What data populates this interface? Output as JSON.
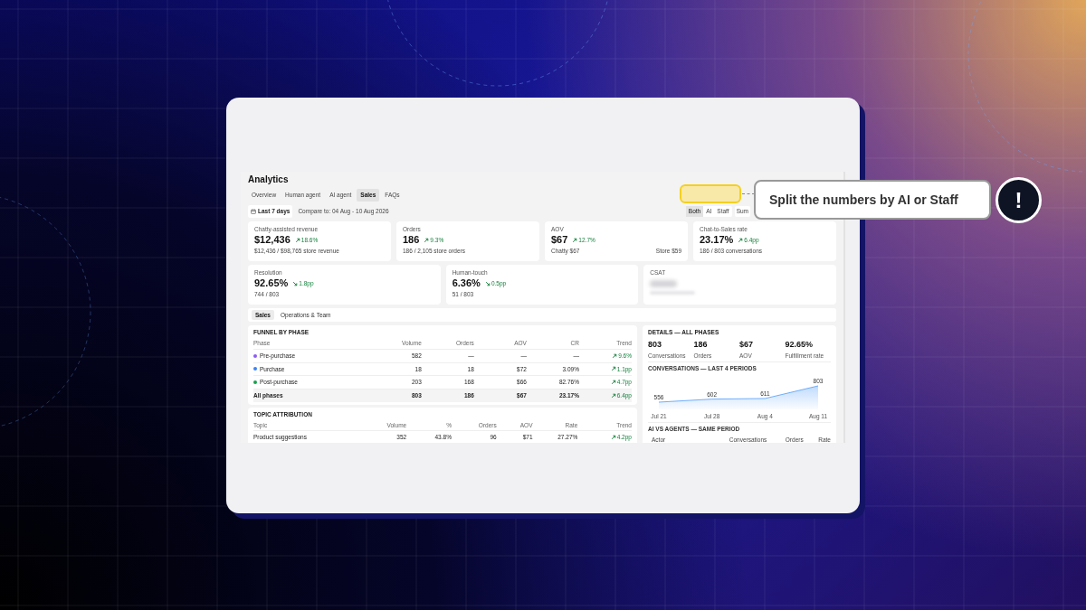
{
  "page": {
    "title": "Analytics",
    "tabs": [
      {
        "label": "Overview",
        "selected": false
      },
      {
        "label": "Human agent",
        "selected": false
      },
      {
        "label": "AI agent",
        "selected": false
      },
      {
        "label": "Sales",
        "selected": true
      },
      {
        "label": "FAQs",
        "selected": false
      }
    ],
    "date_range": "Last 7 days",
    "compare": "Compare to: 04 Aug - 10 Aug 2026",
    "split_toggle": [
      {
        "label": "Both",
        "selected": true
      },
      {
        "label": "AI",
        "selected": false
      },
      {
        "label": "Staff",
        "selected": false
      }
    ],
    "summary_button": "Sum",
    "metric_cards": [
      {
        "label": "Chatty-assisted revenue",
        "value": "$12,436",
        "change": "18.6%",
        "trend_down": false,
        "footer_left": "$12,436 / $98,765 store revenue"
      },
      {
        "label": "Orders",
        "value": "186",
        "change": "9.3%",
        "trend_down": false,
        "footer_left": "186 / 2,105 store orders"
      },
      {
        "label": "AOV",
        "value": "$67",
        "change": "12.7%",
        "trend_down": false,
        "footer_left": "Chatty $67",
        "footer_right": "Store $59"
      },
      {
        "label": "Chat-to-Sales rate",
        "value": "23.17%",
        "change": "6.4pp",
        "trend_down": false,
        "footer_left": "186 / 803 conversations"
      }
    ],
    "metric_cards_2": [
      {
        "kind": "metric",
        "label": "Resolution",
        "value": "92.65%",
        "change": "1.8pp",
        "trend_down": true,
        "footer_left": "744 / 803"
      },
      {
        "kind": "metric",
        "label": "Human-touch",
        "value": "6.36%",
        "change": "0.5pp",
        "trend_down": true,
        "footer_left": "51 / 803"
      },
      {
        "kind": "blurred",
        "label": "CSAT"
      }
    ],
    "section_tabs": [
      {
        "label": "Sales",
        "selected": true
      },
      {
        "label": "Operations & Team",
        "selected": false
      }
    ],
    "funnel": {
      "title": "FUNNEL BY PHASE",
      "columns": [
        "Phase",
        "Volume",
        "Orders",
        "AOV",
        "CR",
        "Trend"
      ],
      "rows": [
        {
          "color": "#8b5cf6",
          "cells": [
            "Pre-purchase",
            "582",
            "—",
            "—",
            "—",
            "9.6%"
          ]
        },
        {
          "color": "#3b82f6",
          "cells": [
            "Purchase",
            "18",
            "18",
            "$72",
            "3.09%",
            "1.1pp"
          ]
        },
        {
          "color": "#16a34a",
          "cells": [
            "Post-purchase",
            "203",
            "168",
            "$66",
            "82.76%",
            "4.7pp"
          ]
        }
      ],
      "total": {
        "cells": [
          "All phases",
          "803",
          "186",
          "$67",
          "23.17%",
          "6.4pp"
        ]
      }
    },
    "topics": {
      "title": "TOPIC ATTRIBUTION",
      "columns": [
        "Topic",
        "Volume",
        "%",
        "Orders",
        "AOV",
        "Rate",
        "Trend"
      ],
      "rows": [
        {
          "cells": [
            "Product suggestions",
            "352",
            "43.8%",
            "96",
            "$71",
            "27.27%",
            "4.2pp"
          ]
        }
      ]
    },
    "details": {
      "title": "DETAILS — ALL PHASES",
      "stats": [
        {
          "value": "803",
          "label": "Conversations"
        },
        {
          "value": "186",
          "label": "Orders"
        },
        {
          "value": "$67",
          "label": "AOV"
        },
        {
          "value": "92.65%",
          "label": "Fulfillment rate"
        }
      ],
      "chart_title": "CONVERSATIONS — LAST 4 PERIODS",
      "chart_data": {
        "type": "area",
        "categories": [
          "Jul 21",
          "Jul 28",
          "Aug 4",
          "Aug 11"
        ],
        "series": [
          {
            "color": "#60a5fa",
            "values": [
              556,
              602,
              611,
              803
            ]
          }
        ],
        "data_labels": true
      },
      "agents_title": "AI VS AGENTS — SAME PERIOD",
      "agents_columns": [
        "Actor",
        "Conversations",
        "Orders",
        "Rate"
      ]
    }
  },
  "callout": {
    "text": "Split the numbers by AI or Staff",
    "badge": "!"
  }
}
